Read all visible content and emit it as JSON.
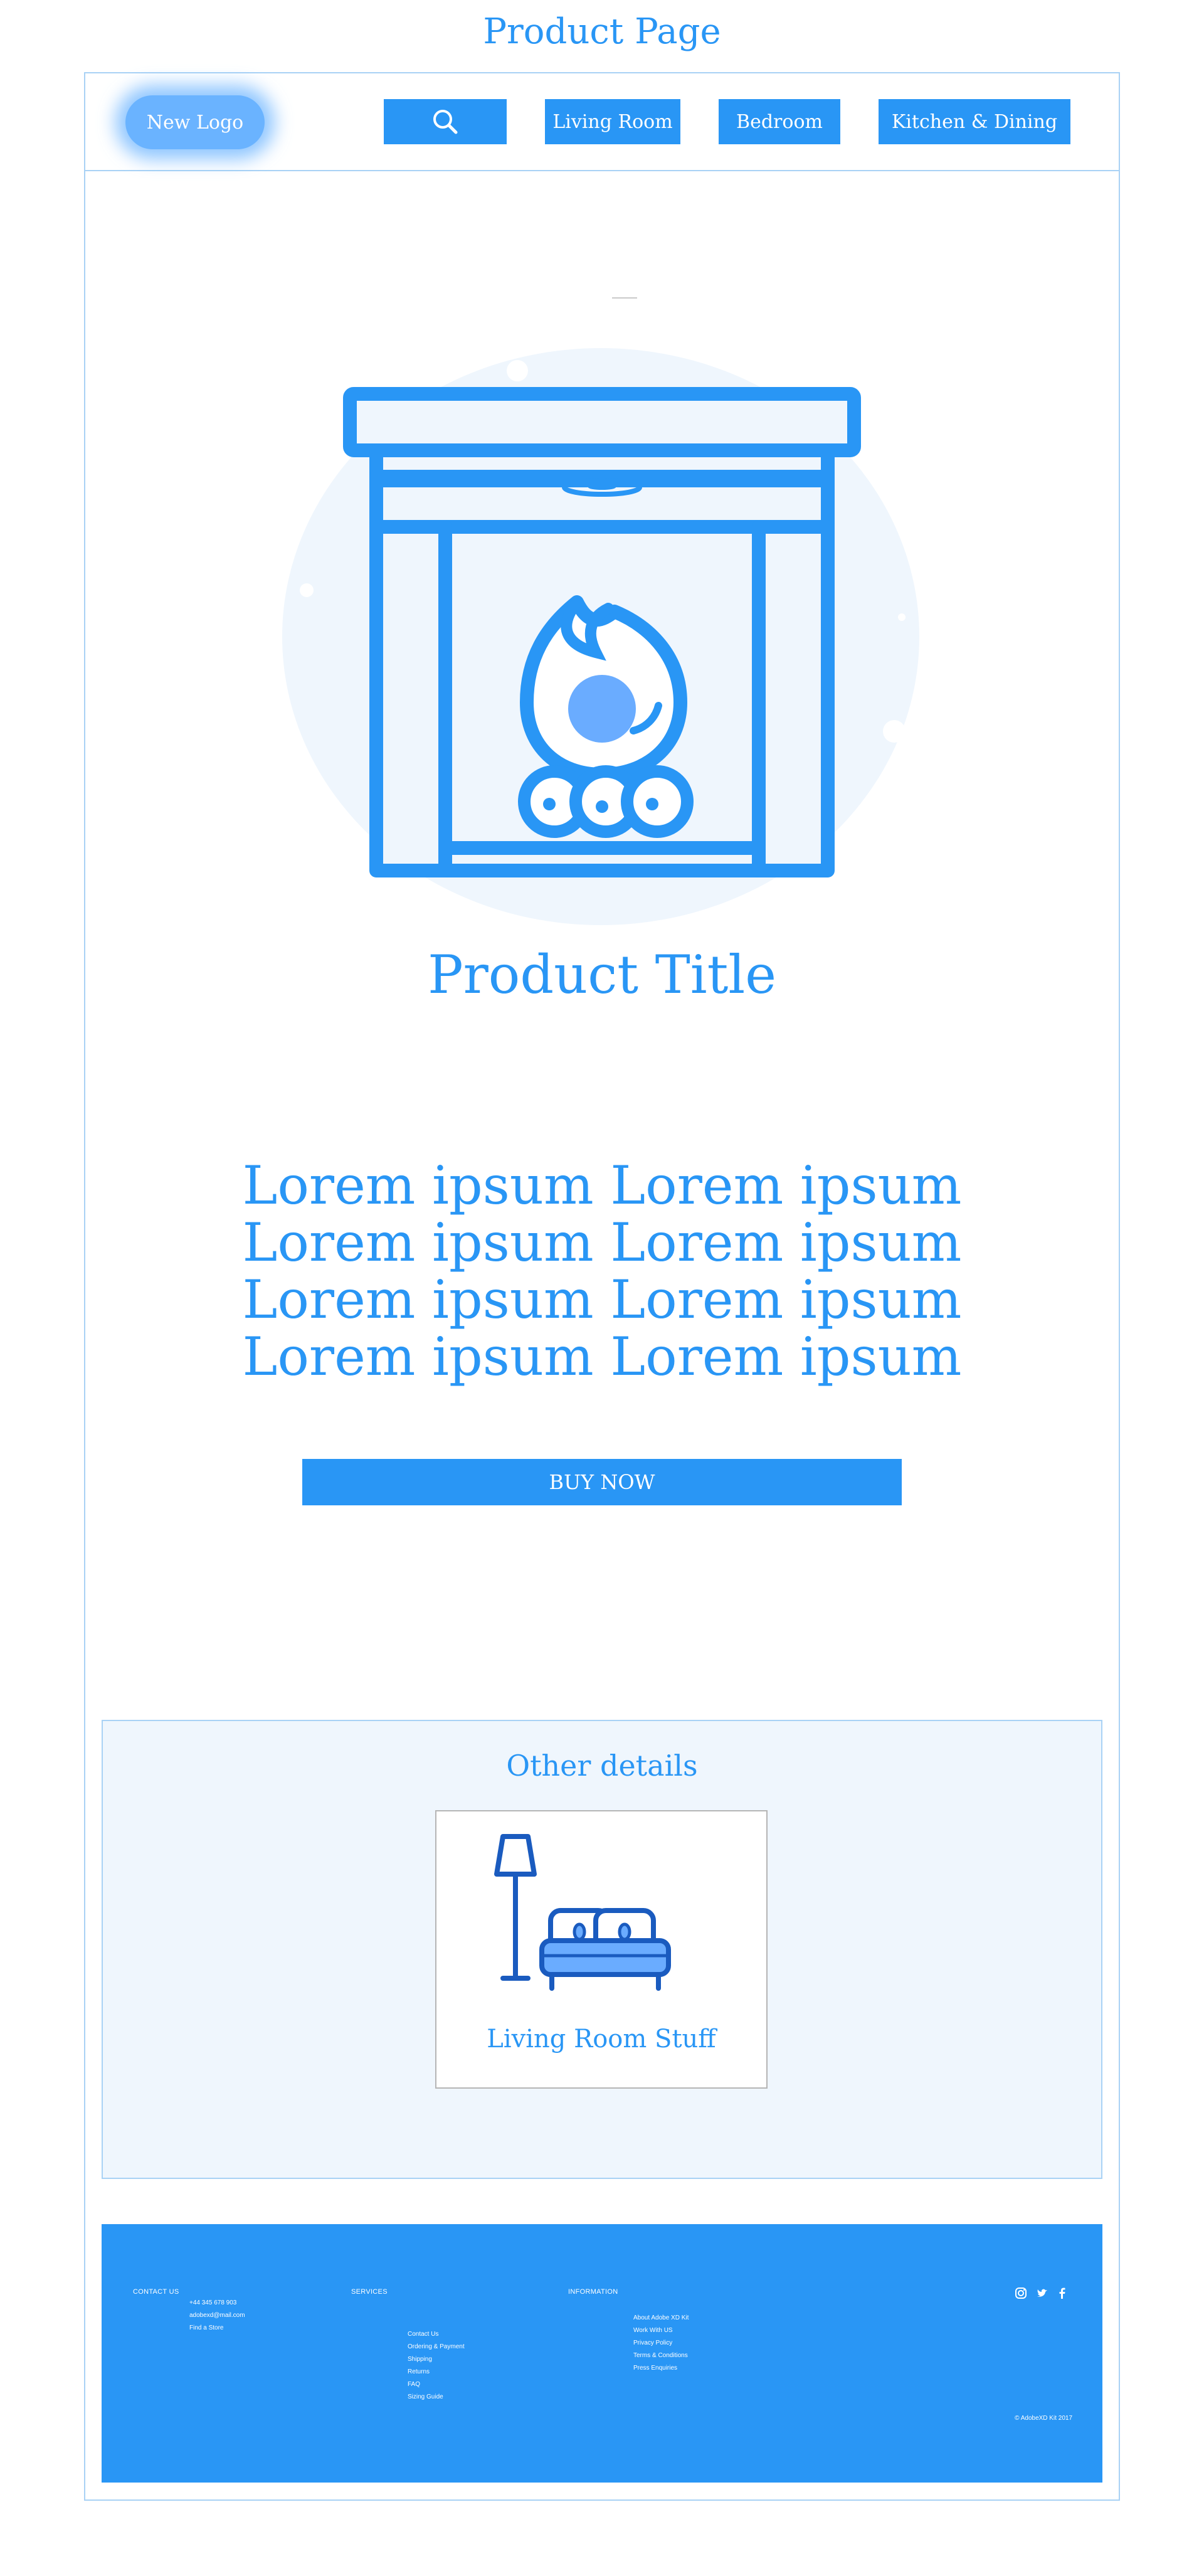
{
  "page": {
    "heading": "Product Page"
  },
  "nav": {
    "logo": "New Logo",
    "search_icon": "search-icon",
    "items": [
      "Living Room",
      "Bedroom",
      "Kitchen & Dining"
    ]
  },
  "hero": {
    "icon": "fireplace-icon",
    "title": "Product Title",
    "description": [
      "Lorem ipsum Lorem ipsum",
      "Lorem ipsum Lorem ipsum",
      "Lorem ipsum Lorem ipsum",
      "Lorem ipsum Lorem ipsum"
    ],
    "buy_label": "BUY NOW"
  },
  "details": {
    "title": "Other details",
    "card": {
      "icon": "living-room-icon",
      "label": "Living Room Stuff"
    }
  },
  "footer": {
    "contact": {
      "heading": "CONTACT US",
      "items": [
        "+44 345 678 903",
        "adobexd@mail.com",
        "Find a Store"
      ]
    },
    "services": {
      "heading": "SERVICES",
      "items": [
        "Contact Us",
        "Ordering & Payment",
        "Shipping",
        "Returns",
        "FAQ",
        "Sizing Guide"
      ]
    },
    "information": {
      "heading": "INFORMATION",
      "items": [
        "About Adobe XD Kit",
        "Work With US",
        "Privacy Policy",
        "Terms & Conditions",
        "Press Enquiries"
      ]
    },
    "social": [
      "instagram-icon",
      "twitter-icon",
      "facebook-icon"
    ],
    "copyright": "© AdobeXD Kit 2017"
  },
  "colors": {
    "accent": "#2996f5",
    "light_bg": "#eff6fd",
    "border": "#a9d2f5"
  }
}
